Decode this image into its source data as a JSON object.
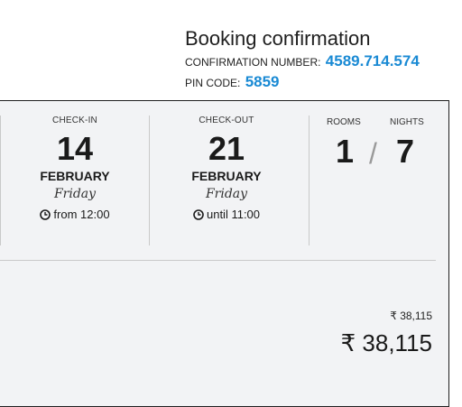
{
  "booking": {
    "title": "Booking confirmation",
    "confirmation_label": "CONFIRMATION NUMBER:",
    "confirmation_number": "4589.714.574",
    "pin_label": "PIN CODE:",
    "pin_code": "5859"
  },
  "stay": {
    "checkin": {
      "label": "CHECK-IN",
      "day": "14",
      "month": "FEBRUARY",
      "weekday": "Friday",
      "time": "from 12:00"
    },
    "checkout": {
      "label": "CHECK-OUT",
      "day": "21",
      "month": "FEBRUARY",
      "weekday": "Friday",
      "time": "until 11:00"
    },
    "rooms_label": "ROOMS",
    "rooms": "1",
    "separator": "/",
    "nights_label": "NIGHTS",
    "nights": "7"
  },
  "price": {
    "small": "₹ 38,115",
    "total": "₹ 38,115"
  },
  "icons": {
    "time": "clock-icon"
  }
}
